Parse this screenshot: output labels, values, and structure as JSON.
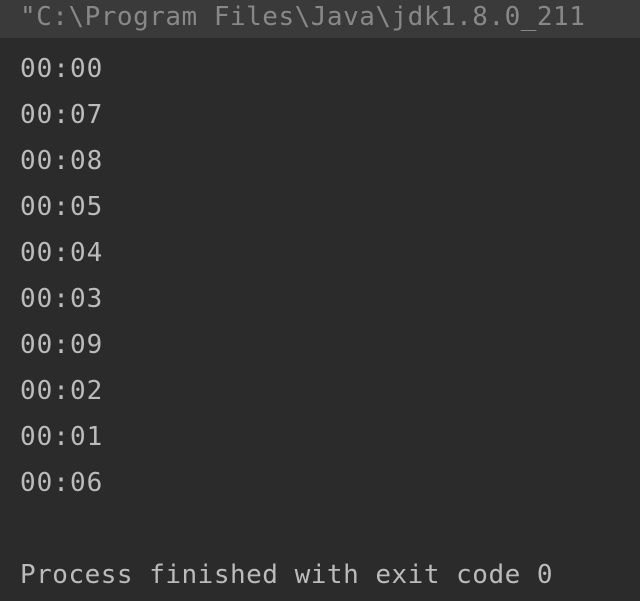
{
  "command": "\"C:\\Program Files\\Java\\jdk1.8.0_211",
  "output_lines": [
    "00:00",
    "00:07",
    "00:08",
    "00:05",
    "00:04",
    "00:03",
    "00:09",
    "00:02",
    "00:01",
    "00:06"
  ],
  "exit_message": "Process finished with exit code 0"
}
